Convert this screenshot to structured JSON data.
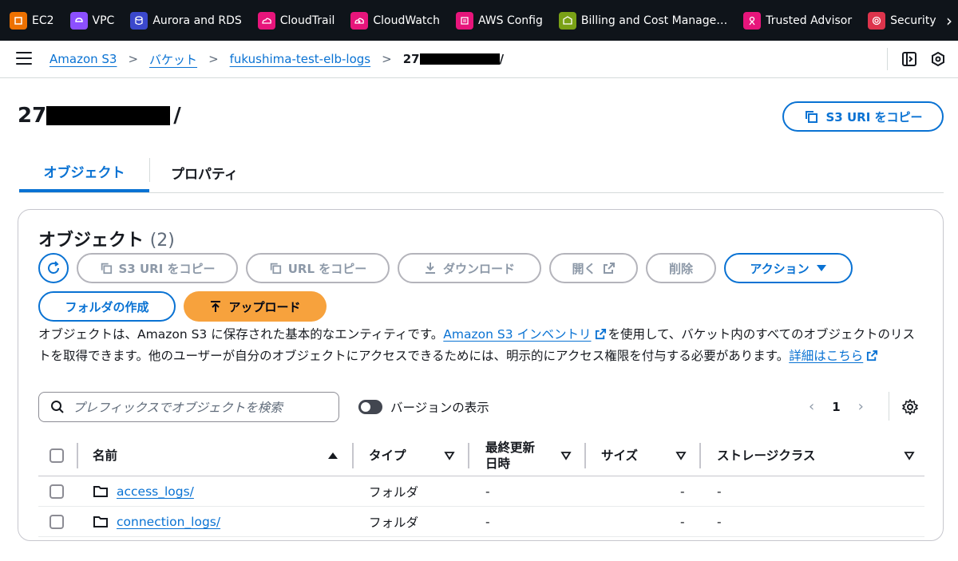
{
  "topbar": {
    "services": [
      {
        "label": "EC2",
        "icon": "ec2-icon",
        "color": "#ed7100"
      },
      {
        "label": "VPC",
        "icon": "vpc-icon",
        "color": "#8c4fff"
      },
      {
        "label": "Aurora and RDS",
        "icon": "rds-icon",
        "color": "#3b48cc"
      },
      {
        "label": "CloudTrail",
        "icon": "cloudtrail-icon",
        "color": "#e7157b"
      },
      {
        "label": "CloudWatch",
        "icon": "cloudwatch-icon",
        "color": "#e7157b"
      },
      {
        "label": "AWS Config",
        "icon": "config-icon",
        "color": "#e7157b"
      },
      {
        "label": "Billing and Cost Manage…",
        "icon": "billing-icon",
        "color": "#7aa116"
      },
      {
        "label": "Trusted Advisor",
        "icon": "trusted-advisor-icon",
        "color": "#e7157b"
      },
      {
        "label": "Security Hub",
        "icon": "security-hub-icon",
        "color": "#dd344c"
      }
    ]
  },
  "breadcrumb": {
    "items": [
      "Amazon S3",
      "バケット",
      "fukushima-test-elb-logs"
    ],
    "current_prefix": "27",
    "current_suffix": "/"
  },
  "header": {
    "title_prefix": "27",
    "title_suffix": "/",
    "copy_uri_label": "S3 URI をコピー"
  },
  "tabs": [
    {
      "label": "オブジェクト",
      "active": true
    },
    {
      "label": "プロパティ",
      "active": false
    }
  ],
  "objects": {
    "title": "オブジェクト",
    "count": "(2)",
    "buttons": {
      "copy_s3_uri": "S3 URI をコピー",
      "copy_url": "URL をコピー",
      "download": "ダウンロード",
      "open": "開く",
      "delete": "削除",
      "actions": "アクション",
      "create_folder": "フォルダの作成",
      "upload": "アップロード"
    },
    "description": {
      "part1": "オブジェクトは、Amazon S3 に保存された基本的なエンティティです。",
      "inventory_link": "Amazon S3 インベントリ",
      "part2": "を使用して、バケット内のすべてのオブジェクトのリストを取得できます。他のユーザーが自分のオブジェクトにアクセスできるためには、明示的にアクセス権限を付与する必要があります。",
      "learn_more": "詳細はこちら"
    },
    "search_placeholder": "プレフィックスでオブジェクトを検索",
    "version_toggle_label": "バージョンの表示",
    "page": "1",
    "columns": {
      "name": "名前",
      "type": "タイプ",
      "modified_line1": "最終更新",
      "modified_line2": "日時",
      "size": "サイズ",
      "storage_class": "ストレージクラス"
    },
    "rows": [
      {
        "name": "access_logs/",
        "type": "フォルダ",
        "modified": "-",
        "size": "-",
        "storage_class": "-"
      },
      {
        "name": "connection_logs/",
        "type": "フォルダ",
        "modified": "-",
        "size": "-",
        "storage_class": "-"
      }
    ]
  }
}
